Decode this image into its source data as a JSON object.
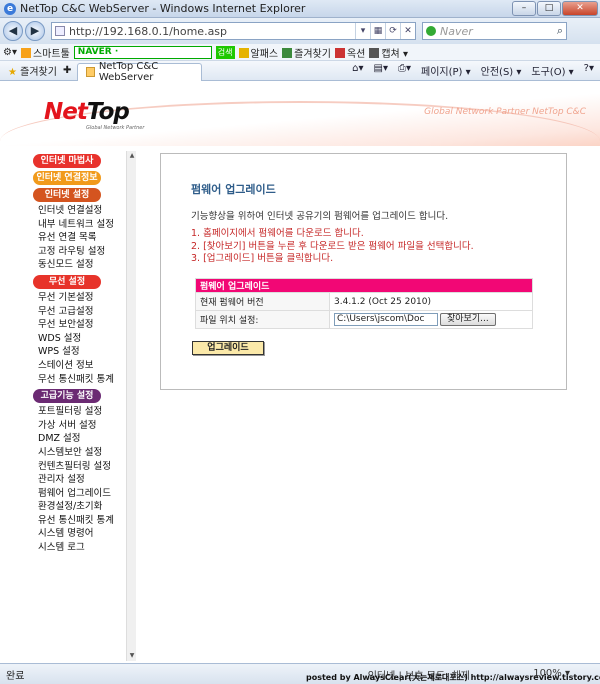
{
  "window": {
    "title": "NetTop C&C WebServer - Windows Internet Explorer"
  },
  "address": {
    "url": "http://192.168.0.1/home.asp",
    "search_placeholder": "Naver"
  },
  "links_bar": {
    "smart_toolbar": "스마트툴",
    "naver_label": "NAVER ·",
    "naver_search_button": "검색",
    "items": [
      "알패스",
      "즐겨찾기",
      "옥션",
      "캡쳐"
    ]
  },
  "tab_bar": {
    "favorites_label": "즐겨찾기",
    "tab_title": "NetTop C&C WebServer",
    "commands": [
      "페이지(P) ▾",
      "안전(S) ▾",
      "도구(O) ▾"
    ]
  },
  "banner": {
    "logo_net": "Net",
    "logo_top": "Top",
    "logo_sub": "Global Network Partner",
    "tagline": "Global Network Partner NetTop C&C"
  },
  "sidebar": {
    "categories": [
      {
        "label": "인터넷 마법사",
        "items": []
      },
      {
        "label": "인터넷 연결정보",
        "items": []
      },
      {
        "label": "인터넷 설정",
        "items": [
          "인터넷 연결설정",
          "내부 네트워크 설정",
          "유선 연결 목록",
          "고정 라우팅 설정",
          "동신모드 설정"
        ]
      },
      {
        "label": "무선 설정",
        "items": [
          "무선 기본설정",
          "무선 고급설정",
          "무선 보안설정",
          "WDS 설정",
          "WPS 설정",
          "스테이션 정보",
          "무선 통신패킷 통계"
        ]
      },
      {
        "label": "고급기능 설정",
        "items": [
          "포트필터링 설정",
          "가상 서버 설정",
          "DMZ 설정",
          "시스템보안 설정",
          "컨텐츠필터링 설정",
          "관리자 설정",
          "펌웨어 업그레이드",
          "환경설정/초기화",
          "유선 통신패킷 통계",
          "시스템 명령어",
          "시스템 로그"
        ]
      }
    ]
  },
  "content": {
    "title": "펌웨어 업그레이드",
    "description": "기능향상을 위하여 인터넷 공유기의 펌웨어를 업그레이드 합니다.",
    "steps": [
      "1. 홈페이지에서 펌웨어를 다운로드 합니다.",
      "2. [찾아보기] 버튼을 누른 후 다운로드 받은 펌웨어 파일을 선택합니다.",
      "3. [업그레이드] 버튼을 클릭합니다."
    ],
    "table": {
      "header": "펌웨어 업그레이드",
      "current_label": "현재 펌웨어 버전",
      "current_value": "3.4.1.2 (Oct 25 2010)",
      "file_label": "파일 위치 설정:",
      "file_value": "C:\\Users\\jscom\\Doc",
      "browse_label": "찾아보기..."
    },
    "upgrade_button": "업그레이드"
  },
  "status": {
    "left": "완료",
    "zone": "인터넷 | 보호 모드: 해제",
    "zoom": "100% ▾",
    "credit": "posted by AlwaysClear(大는재로대포스) http://alwaysreview.tistory.com/"
  }
}
